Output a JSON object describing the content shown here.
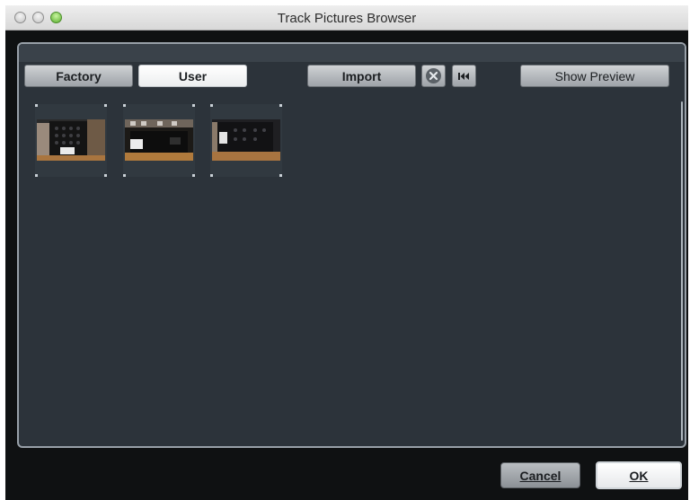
{
  "window": {
    "title": "Track Pictures Browser"
  },
  "toolbar": {
    "factory_label": "Factory",
    "user_label": "User",
    "import_label": "Import",
    "remove_icon": "remove-icon",
    "rewind_icon": "skip-to-start-icon",
    "show_preview_label": "Show Preview",
    "selected_tab": "User"
  },
  "pictures": [
    {
      "icon": "track-picture-thumbnail"
    },
    {
      "icon": "track-picture-thumbnail"
    },
    {
      "icon": "track-picture-thumbnail"
    }
  ],
  "footer": {
    "cancel_label": "Cancel",
    "ok_label": "OK"
  }
}
